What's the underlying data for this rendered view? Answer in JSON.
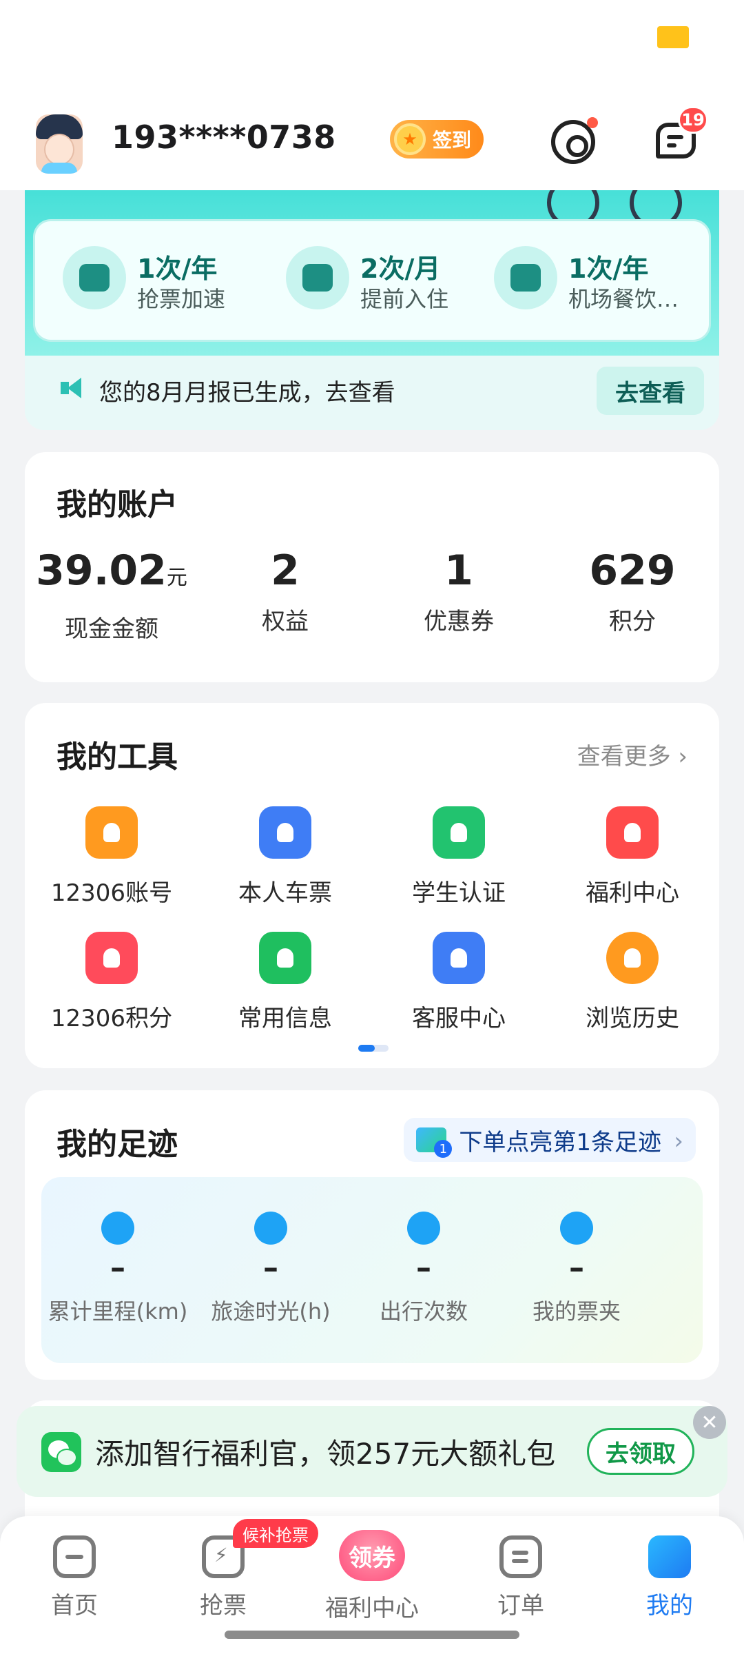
{
  "header": {
    "phone": "193****0738",
    "signin_label": "签到",
    "message_badge": "19"
  },
  "benefits": {
    "items": [
      {
        "title": "1次/年",
        "subtitle": "抢票加速"
      },
      {
        "title": "2次/月",
        "subtitle": "提前入住"
      },
      {
        "title": "1次/年",
        "subtitle": "机场餐饮…"
      }
    ],
    "report_text": "您的8月月报已生成，去查看",
    "report_button": "去查看"
  },
  "account": {
    "title": "我的账户",
    "items": [
      {
        "value": "39.02",
        "unit": "元",
        "label": "现金金额"
      },
      {
        "value": "2",
        "label": "权益"
      },
      {
        "value": "1",
        "label": "优惠券"
      },
      {
        "value": "629",
        "label": "积分"
      }
    ]
  },
  "tools": {
    "title": "我的工具",
    "more": "查看更多",
    "items": [
      {
        "label": "12306账号",
        "color": "#ff9a1f"
      },
      {
        "label": "本人车票",
        "color": "#3f7df5"
      },
      {
        "label": "学生认证",
        "color": "#22c36f"
      },
      {
        "label": "福利中心",
        "color": "#ff4b4b"
      },
      {
        "label": "12306积分",
        "color": "#ff4b5b"
      },
      {
        "label": "常用信息",
        "color": "#1fbf5f"
      },
      {
        "label": "客服中心",
        "color": "#3f7df5"
      },
      {
        "label": "浏览历史",
        "color": "#ff9a1f"
      }
    ]
  },
  "footprint": {
    "title": "我的足迹",
    "cta": "下单点亮第1条足迹",
    "cta_badge": "1",
    "items": [
      {
        "value": "–",
        "label": "累计里程(km)"
      },
      {
        "value": "–",
        "label": "旅途时光(h)"
      },
      {
        "value": "–",
        "label": "出行次数"
      },
      {
        "value": "–",
        "label": "我的票夹"
      }
    ]
  },
  "promo": {
    "text": "添加智行福利官，领257元大额礼包",
    "button": "去领取",
    "close": "✕"
  },
  "nav": {
    "items": [
      {
        "label": "首页"
      },
      {
        "label": "抢票"
      },
      {
        "label": "福利中心",
        "icon_text": "领券"
      },
      {
        "label": "订单"
      },
      {
        "label": "我的"
      }
    ],
    "badge": "候补抢票"
  }
}
